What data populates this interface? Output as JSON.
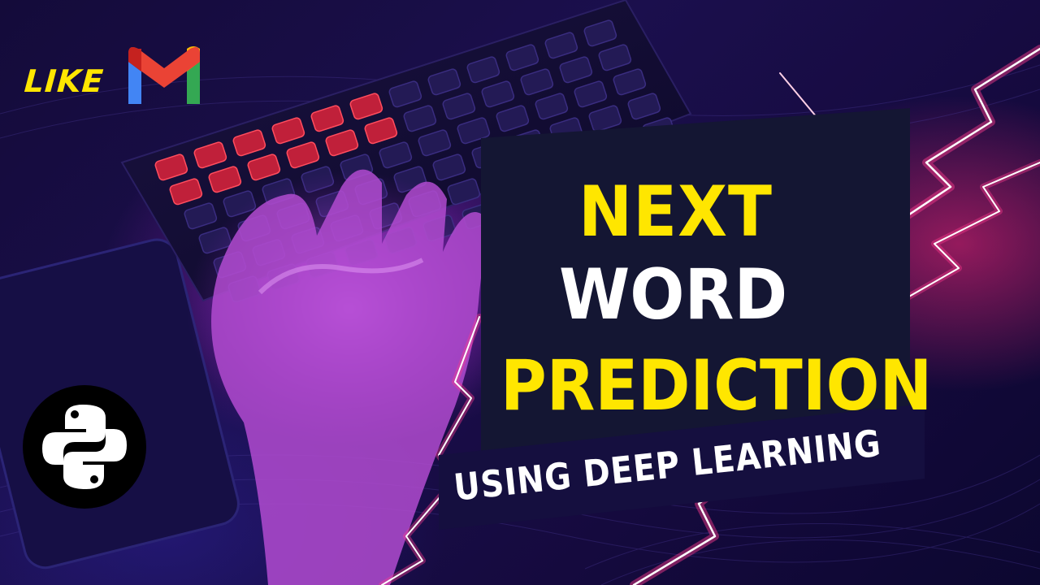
{
  "like_badge": {
    "label": "LIKE"
  },
  "title": {
    "line1": "NEXT",
    "line2": "WORD",
    "line3": "PREDICTION"
  },
  "subtitle": "USING DEEP LEARNING",
  "colors": {
    "yellow": "#ffe600",
    "white": "#ffffff",
    "panel": "#141633",
    "background": "#150a3e",
    "glow_magenta": "#d12cd9",
    "glow_pink": "#ff2a6d"
  },
  "icons": [
    "gmail-logo-icon",
    "python-logo-icon",
    "keyboard-image",
    "hand-image",
    "lightning-icon"
  ]
}
